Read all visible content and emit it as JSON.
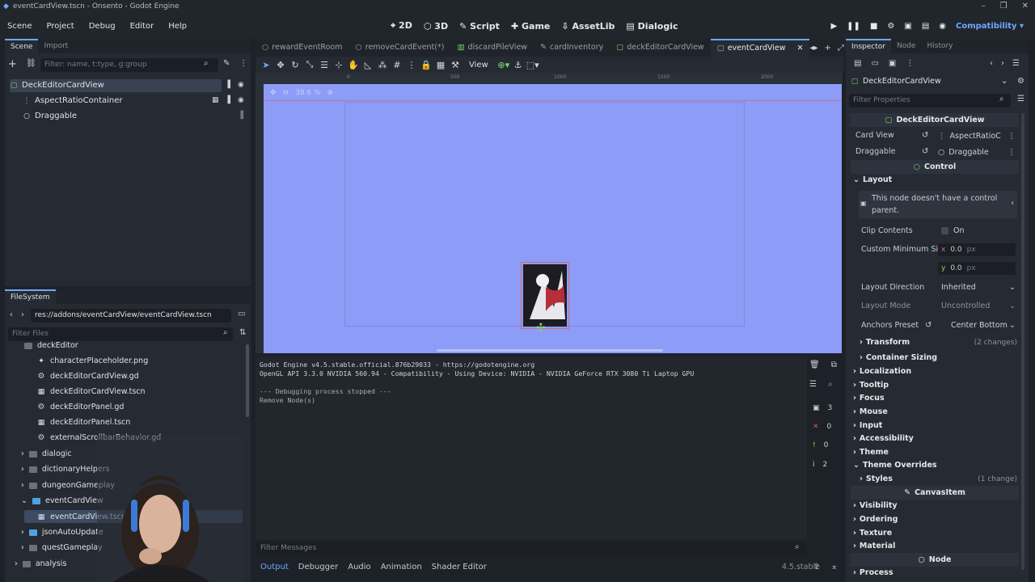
{
  "window": {
    "title": "eventCardView.tscn - Onsento - Godot Engine"
  },
  "menu": [
    "Scene",
    "Project",
    "Debug",
    "Editor",
    "Help"
  ],
  "workspaces": [
    "2D",
    "3D",
    "Script",
    "Game",
    "AssetLib",
    "Dialogic"
  ],
  "renderer": "Compatibility",
  "scene_dock": {
    "tabs": [
      "Scene",
      "Import"
    ],
    "filter_placeholder": "Filter: name, t:type, g:group",
    "nodes": [
      {
        "name": "DeckEditorCardView",
        "icon": "control-icon"
      },
      {
        "name": "AspectRatioContainer",
        "icon": "container-icon"
      },
      {
        "name": "Draggable",
        "icon": "node-icon"
      }
    ]
  },
  "filesystem": {
    "title": "FileSystem",
    "path": "res://addons/eventCardView/eventCardView.tscn",
    "filter_placeholder": "Filter Files",
    "items": [
      {
        "label": "deckEditor",
        "type": "folder-open"
      },
      {
        "label": "characterPlaceholder.png",
        "type": "image"
      },
      {
        "label": "deckEditorCardView.gd",
        "type": "script"
      },
      {
        "label": "deckEditorCardView.tscn",
        "type": "scene"
      },
      {
        "label": "deckEditorPanel.gd",
        "type": "script"
      },
      {
        "label": "deckEditorPanel.tscn",
        "type": "scene"
      },
      {
        "label": "externalScrollbarBehavior.gd",
        "type": "script"
      },
      {
        "label": "dialogic",
        "type": "folder"
      },
      {
        "label": "dictionaryHelpers",
        "type": "folder"
      },
      {
        "label": "dungeonGameplay",
        "type": "folder"
      },
      {
        "label": "eventCardView",
        "type": "folder-open"
      },
      {
        "label": "eventCardView.tscn",
        "type": "scene"
      },
      {
        "label": "jsonAutoUpdate",
        "type": "folder"
      },
      {
        "label": "questGameplay",
        "type": "folder"
      },
      {
        "label": "analysis",
        "type": "folder"
      }
    ]
  },
  "editor_tabs": [
    "rewardEventRoom",
    "removeCardEvent(*)",
    "discardPileView",
    "cardInventory",
    "deckEditorCardView",
    "eventCardView"
  ],
  "toolbar": {
    "view_label": "View"
  },
  "viewport": {
    "zoom": "38.6 %",
    "ruler_labels": [
      "0",
      "500",
      "1000",
      "1500",
      "2000"
    ]
  },
  "console": {
    "lines": [
      "Godot Engine v4.5.stable.official.876b29033 - https://godotengine.org",
      "OpenGL API 3.3.0 NVIDIA 560.94 - Compatibility - Using Device: NVIDIA - NVIDIA GeForce RTX 3080 Ti Laptop GPU",
      "",
      "--- Debugging process stopped ---",
      "Remove Node(s)"
    ],
    "filter_placeholder": "Filter Messages",
    "counts": {
      "messages": "3",
      "errors": "0",
      "warnings": "0",
      "info": "2"
    }
  },
  "bottom_tabs": [
    "Output",
    "Debugger",
    "Audio",
    "Animation",
    "Shader Editor"
  ],
  "version": "4.5.stable",
  "inspector": {
    "tabs": [
      "Inspector",
      "Node",
      "History"
    ],
    "object": "DeckEditorCardView",
    "filter_placeholder": "Filter Properties",
    "script_section": "DeckEditorCardView",
    "card_view_label": "Card View",
    "card_view_value": "AspectRatioC",
    "draggable_label": "Draggable",
    "draggable_value": "Draggable",
    "control_section": "Control",
    "layout_label": "Layout",
    "warning": "This node doesn't have a control parent.",
    "clip_label": "Clip Contents",
    "clip_value": "On",
    "min_size_label": "Custom Minimum Si",
    "min_x": "0.0",
    "min_y": "0.0",
    "unit": "px",
    "layout_dir_label": "Layout Direction",
    "layout_dir_value": "Inherited",
    "layout_mode_label": "Layout Mode",
    "layout_mode_value": "Uncontrolled",
    "anchors_label": "Anchors Preset",
    "anchors_value": "Center Bottom",
    "transform_label": "Transform",
    "transform_changes": "(2 changes)",
    "container_sizing_label": "Container Sizing",
    "categories": [
      "Localization",
      "Tooltip",
      "Focus",
      "Mouse",
      "Input",
      "Accessibility",
      "Theme"
    ],
    "theme_overrides_label": "Theme Overrides",
    "styles_label": "Styles",
    "styles_changes": "(1 change)",
    "canvasitem_section": "CanvasItem",
    "canvas_categories": [
      "Visibility",
      "Ordering",
      "Texture",
      "Material"
    ],
    "node_section": "Node",
    "process_label": "Process"
  },
  "colors": {
    "accent": "#6ea8ff",
    "viewport_bg": "#8c9cf7",
    "panel": "#262b33"
  }
}
